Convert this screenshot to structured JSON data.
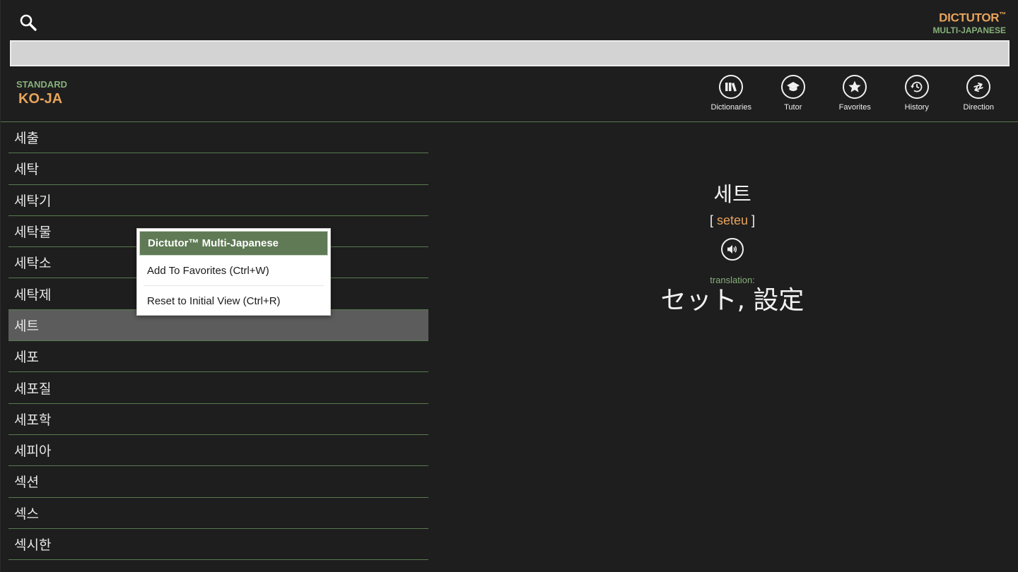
{
  "brand": {
    "name": "DICTUTOR",
    "tm": "™",
    "subtitle": "MULTI-JAPANESE"
  },
  "search": {
    "value": "",
    "placeholder": ""
  },
  "mode": {
    "label": "STANDARD",
    "value": "KO-JA"
  },
  "toolbar": [
    {
      "label": "Dictionaries",
      "icon": "books-icon"
    },
    {
      "label": "Tutor",
      "icon": "graduation-cap-icon"
    },
    {
      "label": "Favorites",
      "icon": "star-icon"
    },
    {
      "label": "History",
      "icon": "history-clock-icon"
    },
    {
      "label": "Direction",
      "icon": "swap-arrows-icon"
    }
  ],
  "word_list": [
    "세출",
    "세탁",
    "세탁기",
    "세탁물",
    "세탁소",
    "세탁제",
    "세트",
    "세포",
    "세포질",
    "세포학",
    "세피아",
    "섹션",
    "섹스",
    "섹시한"
  ],
  "selected_index": 6,
  "detail": {
    "headword": "세트",
    "pron_open": "[",
    "pronunciation": "seteu",
    "pron_close": "]",
    "translation_label": "translation:",
    "translation": "セット, 設定"
  },
  "context_menu": {
    "title": "Dictutor™ Multi-Japanese",
    "items": [
      "Add To Favorites (Ctrl+W)",
      "Reset to Initial View (Ctrl+R)"
    ]
  },
  "colors": {
    "accent_orange": "#e8a35c",
    "accent_green": "#86b07a",
    "menu_title_bg": "#5f7a55",
    "selected_row": "#5c5c5c"
  }
}
